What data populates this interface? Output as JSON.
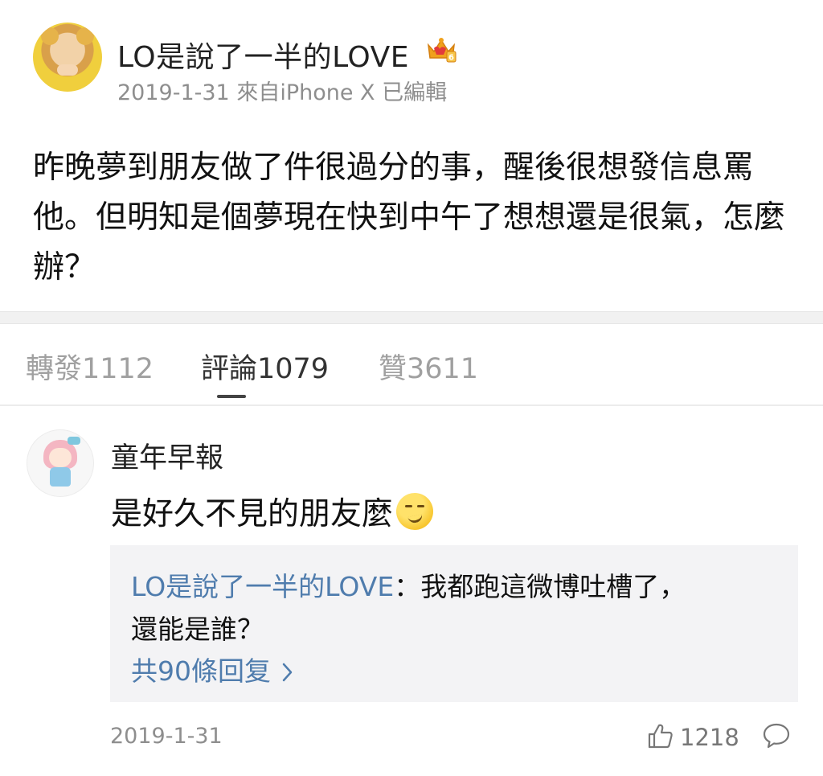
{
  "post": {
    "username": "LO是說了一半的LOVE",
    "meta": "2019-1-31  來自iPhone X 已編輯",
    "text": "昨晚夢到朋友做了件很過分的事，醒後很想發信息罵他。但明知是個夢現在快到中午了想想還是很氣，怎麼辦？"
  },
  "tabs": [
    {
      "label": "轉發1112"
    },
    {
      "label": "評論1079"
    },
    {
      "label": "贊3611"
    }
  ],
  "comment": {
    "username": "童年早報",
    "text": "是好久不見的朋友麼",
    "emoji": "smirk-emoji",
    "reply": {
      "author": "LO是說了一半的LOVE",
      "text_line1": "：我都跑這微博吐槽了，",
      "text_line2": "還能是誰？",
      "more": "共90條回复"
    },
    "date": "2019-1-31",
    "likes": "1218"
  },
  "icons": {
    "crown": "crown-badge-icon",
    "like": "thumbs-up-icon",
    "comment": "comment-bubble-icon",
    "chevron": "chevron-right-icon"
  },
  "colors": {
    "link": "#4f7cad",
    "muted": "#8e8e8e",
    "reply_bg": "#f3f3f5"
  }
}
